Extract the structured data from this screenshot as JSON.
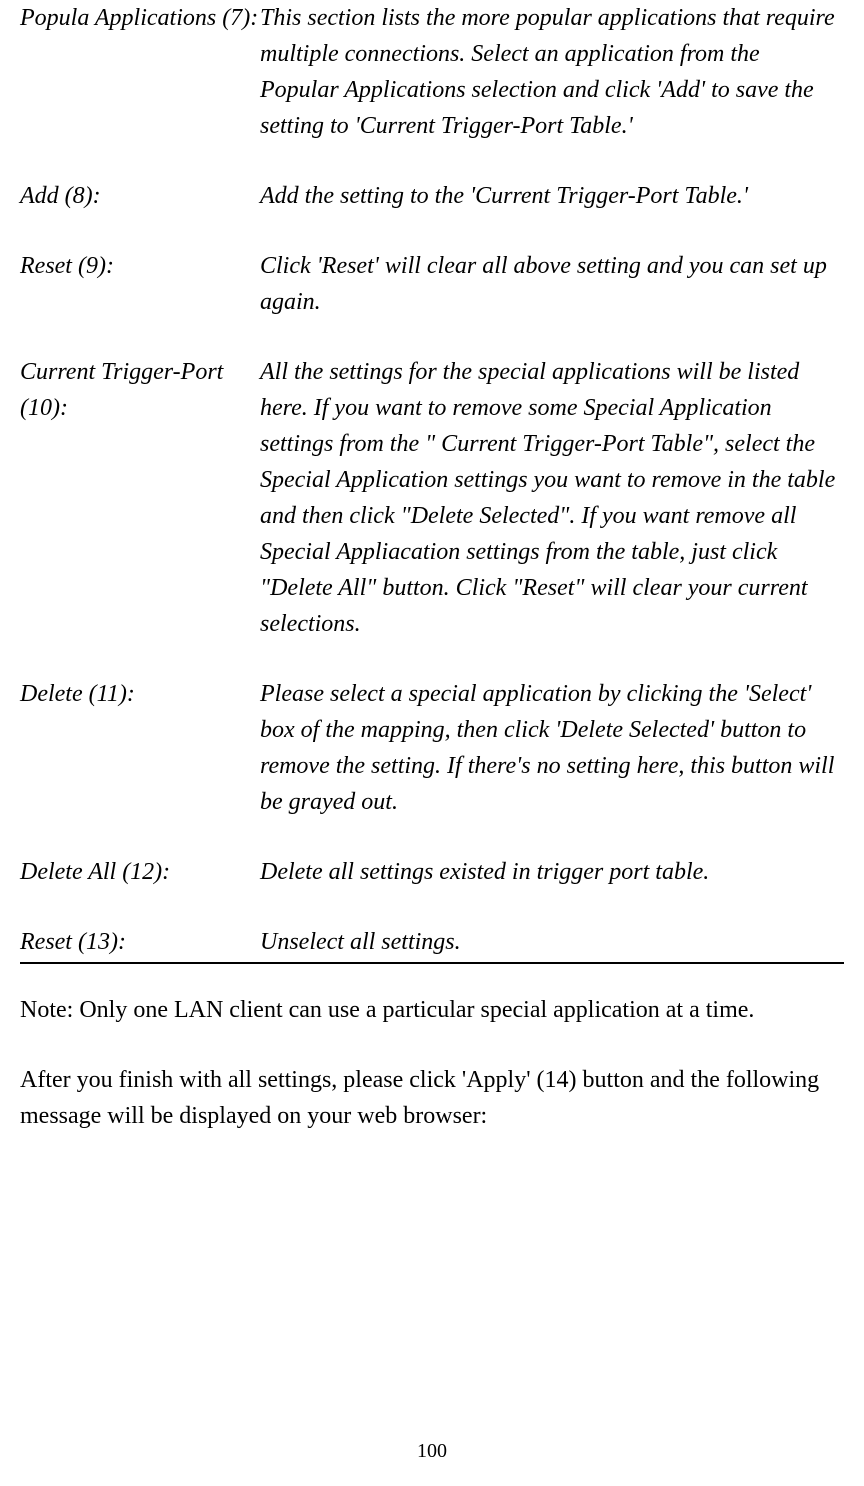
{
  "definitions": [
    {
      "term": "Popula Applications (7):",
      "desc": "This section lists the more popular applications that require multiple connections. Select an application from the Popular Applications selection and click 'Add' to save the setting to 'Current Trigger-Port Table.'"
    },
    {
      "term": "Add (8):",
      "desc": "Add the setting to the 'Current Trigger-Port Table.'"
    },
    {
      "term": "Reset (9):",
      "desc": "Click 'Reset' will clear all above setting and you can set up again."
    },
    {
      "term": "Current Trigger-Port (10):",
      "desc": "All the settings for the special applications will be listed here. If you want to remove some Special Application settings from the \" Current Trigger-Port Table\", select the Special Application settings you want to remove in the table and then click \"Delete Selected\". If you want remove all Special Appliacation settings from the table, just click \"Delete All\" button. Click \"Reset\" will clear your current selections."
    },
    {
      "term": "Delete (11):",
      "desc": "Please select a special application by clicking the 'Select' box of the mapping, then click 'Delete Selected' button to remove the setting. If there's no setting here, this button will be grayed out."
    },
    {
      "term": "Delete All (12):",
      "desc": "Delete all settings existed in trigger port table."
    },
    {
      "term": "Reset (13):",
      "desc": "Unselect all settings."
    }
  ],
  "note": "Note: Only one LAN client can use a particular special application at a time.",
  "afterNote": "After you finish with all settings, please click 'Apply' (14) button and the following message will be displayed on your web browser:",
  "pageNumber": "100"
}
